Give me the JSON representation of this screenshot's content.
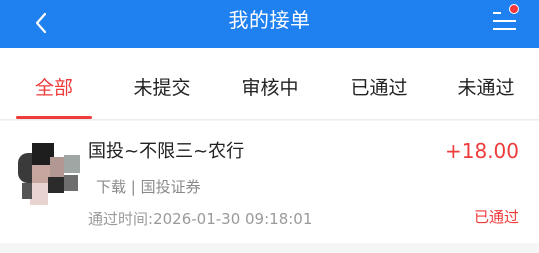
{
  "header": {
    "title": "我的接单",
    "back_icon": "chevron-left-icon",
    "menu_icon": "list-menu-icon",
    "menu_badge_color": "#f5363d",
    "background": "#1f80f0"
  },
  "tabs": [
    {
      "label": "全部",
      "active": true
    },
    {
      "label": "未提交",
      "active": false
    },
    {
      "label": "审核中",
      "active": false
    },
    {
      "label": "已通过",
      "active": false
    },
    {
      "label": "未通过",
      "active": false
    }
  ],
  "accent_color": "#ee3b3b",
  "orders": [
    {
      "name": "国投~不限三~农行",
      "subtitle": "下载 | 国投证券",
      "time_label": "通过时间:",
      "time": "2026-01-30 09:18:01",
      "amount": "+18.00",
      "status": "已通过",
      "avatar": "blurred-avatar"
    }
  ]
}
